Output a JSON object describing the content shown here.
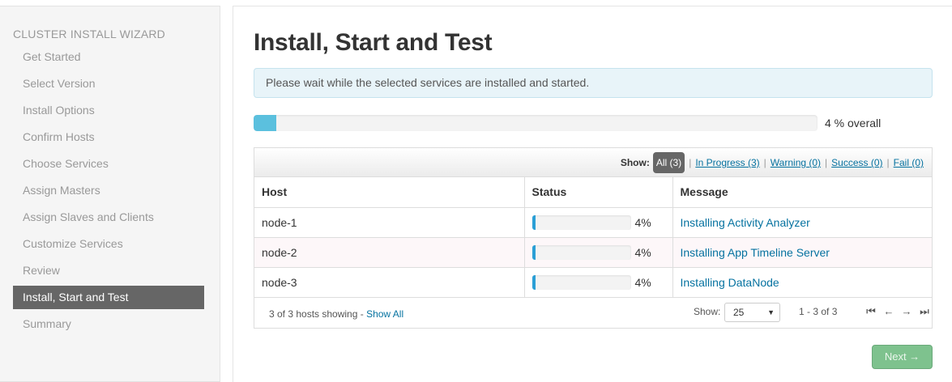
{
  "sidebar": {
    "title": "CLUSTER INSTALL WIZARD",
    "steps": [
      {
        "label": "Get Started"
      },
      {
        "label": "Select Version"
      },
      {
        "label": "Install Options"
      },
      {
        "label": "Confirm Hosts"
      },
      {
        "label": "Choose Services"
      },
      {
        "label": "Assign Masters"
      },
      {
        "label": "Assign Slaves and Clients"
      },
      {
        "label": "Customize Services"
      },
      {
        "label": "Review"
      },
      {
        "label": "Install, Start and Test"
      },
      {
        "label": "Summary"
      }
    ],
    "active_step": "Install, Start and Test"
  },
  "main": {
    "title": "Install, Start and Test",
    "alert": "Please wait while the selected services are installed and started.",
    "overall_progress": 4,
    "overall_label": "4 % overall"
  },
  "filters": {
    "show_label": "Show:",
    "all": "All (3)",
    "in_progress": "In Progress (3)",
    "warning": "Warning (0)",
    "success": "Success (0)",
    "fail": "Fail (0)",
    "separator": "|"
  },
  "table": {
    "headers": {
      "host": "Host",
      "status": "Status",
      "message": "Message"
    },
    "rows": [
      {
        "host": "node-1",
        "progress": 4,
        "progress_label": "4%",
        "message": "Installing Activity Analyzer"
      },
      {
        "host": "node-2",
        "progress": 4,
        "progress_label": "4%",
        "message": "Installing App Timeline Server"
      },
      {
        "host": "node-3",
        "progress": 4,
        "progress_label": "4%",
        "message": "Installing DataNode"
      }
    ]
  },
  "footer": {
    "count_text": "3 of 3 hosts showing - ",
    "show_all": "Show All",
    "show_label": "Show:",
    "page_size": "25",
    "range": "1 - 3 of 3",
    "pager_icons": [
      "first-page-icon",
      "prev-page-icon",
      "next-page-icon",
      "last-page-icon"
    ]
  },
  "next_button": "Next →",
  "colors": {
    "accent": "#0572a0",
    "progress_fill": "#5bc0de",
    "active_step_bg": "#666666",
    "next_button_bg": "#7ec28e"
  }
}
